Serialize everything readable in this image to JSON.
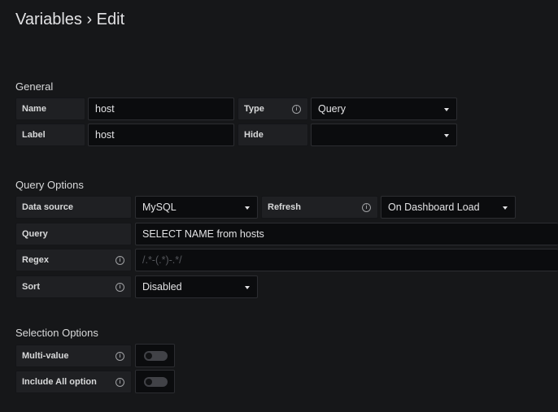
{
  "header": {
    "title": "Variables › Edit"
  },
  "general": {
    "heading": "General",
    "name_label": "Name",
    "name_value": "host",
    "type_label": "Type",
    "type_value": "Query",
    "label_label": "Label",
    "label_value": "host",
    "hide_label": "Hide",
    "hide_value": ""
  },
  "query_options": {
    "heading": "Query Options",
    "datasource_label": "Data source",
    "datasource_value": "MySQL",
    "refresh_label": "Refresh",
    "refresh_value": "On Dashboard Load",
    "query_label": "Query",
    "query_value": "SELECT NAME from hosts",
    "regex_label": "Regex",
    "regex_placeholder": "/.*-(.*)-.*/",
    "sort_label": "Sort",
    "sort_value": "Disabled"
  },
  "selection_options": {
    "heading": "Selection Options",
    "multivalue_label": "Multi-value",
    "multivalue_on": false,
    "include_all_label": "Include All option",
    "include_all_on": false
  }
}
